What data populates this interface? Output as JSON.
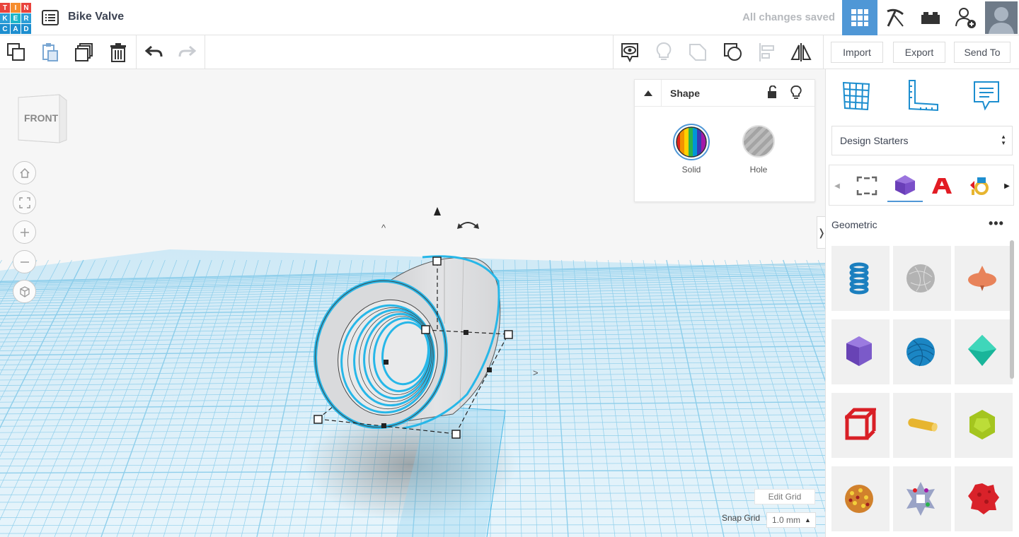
{
  "app": {
    "logo_letters": [
      "T",
      "I",
      "N",
      "K",
      "E",
      "R",
      "C",
      "A",
      "D"
    ],
    "logo_colors": [
      "#e9433c",
      "#f68d2e",
      "#e9433c",
      "#2c9ed7",
      "#1eb6c9",
      "#2c9ed7",
      "#1d8ecf",
      "#1d8ecf",
      "#1d8ecf"
    ],
    "project_title": "Bike Valve",
    "save_status": "All changes saved"
  },
  "toolbar": {
    "import_label": "Import",
    "export_label": "Export",
    "send_to_label": "Send To"
  },
  "viewcube": {
    "label": "FRONT"
  },
  "shape_panel": {
    "title": "Shape",
    "solid_label": "Solid",
    "hole_label": "Hole"
  },
  "grid_controls": {
    "edit_grid_label": "Edit Grid",
    "snap_grid_label": "Snap Grid",
    "snap_grid_value": "1.0 mm"
  },
  "side_panel": {
    "library_dropdown": "Design Starters",
    "section_title": "Geometric",
    "more_icon": "more-options-icon",
    "shapes": [
      {
        "name": "spring",
        "color": "#1b7fbf"
      },
      {
        "name": "scribble-sphere",
        "color": "#b3b3b3"
      },
      {
        "name": "top",
        "color": "#e8835a"
      },
      {
        "name": "icosahedron",
        "color": "#7b5ac9"
      },
      {
        "name": "yarn-ball",
        "color": "#1b86c4"
      },
      {
        "name": "octahedron",
        "color": "#19b59a"
      },
      {
        "name": "cube-frame",
        "color": "#d91f26"
      },
      {
        "name": "cylinder-rod",
        "color": "#e7b530"
      },
      {
        "name": "dodecahedron",
        "color": "#a4c51f"
      },
      {
        "name": "dotted-sphere",
        "color": "#d1812c"
      },
      {
        "name": "gem-cluster",
        "color": "#9aa3c6"
      },
      {
        "name": "crumpled-ball",
        "color": "#d9222a"
      }
    ]
  },
  "colors": {
    "accent": "#4f97d6",
    "grid_blue": "#5db9e3",
    "selection": "#27b7e8"
  }
}
